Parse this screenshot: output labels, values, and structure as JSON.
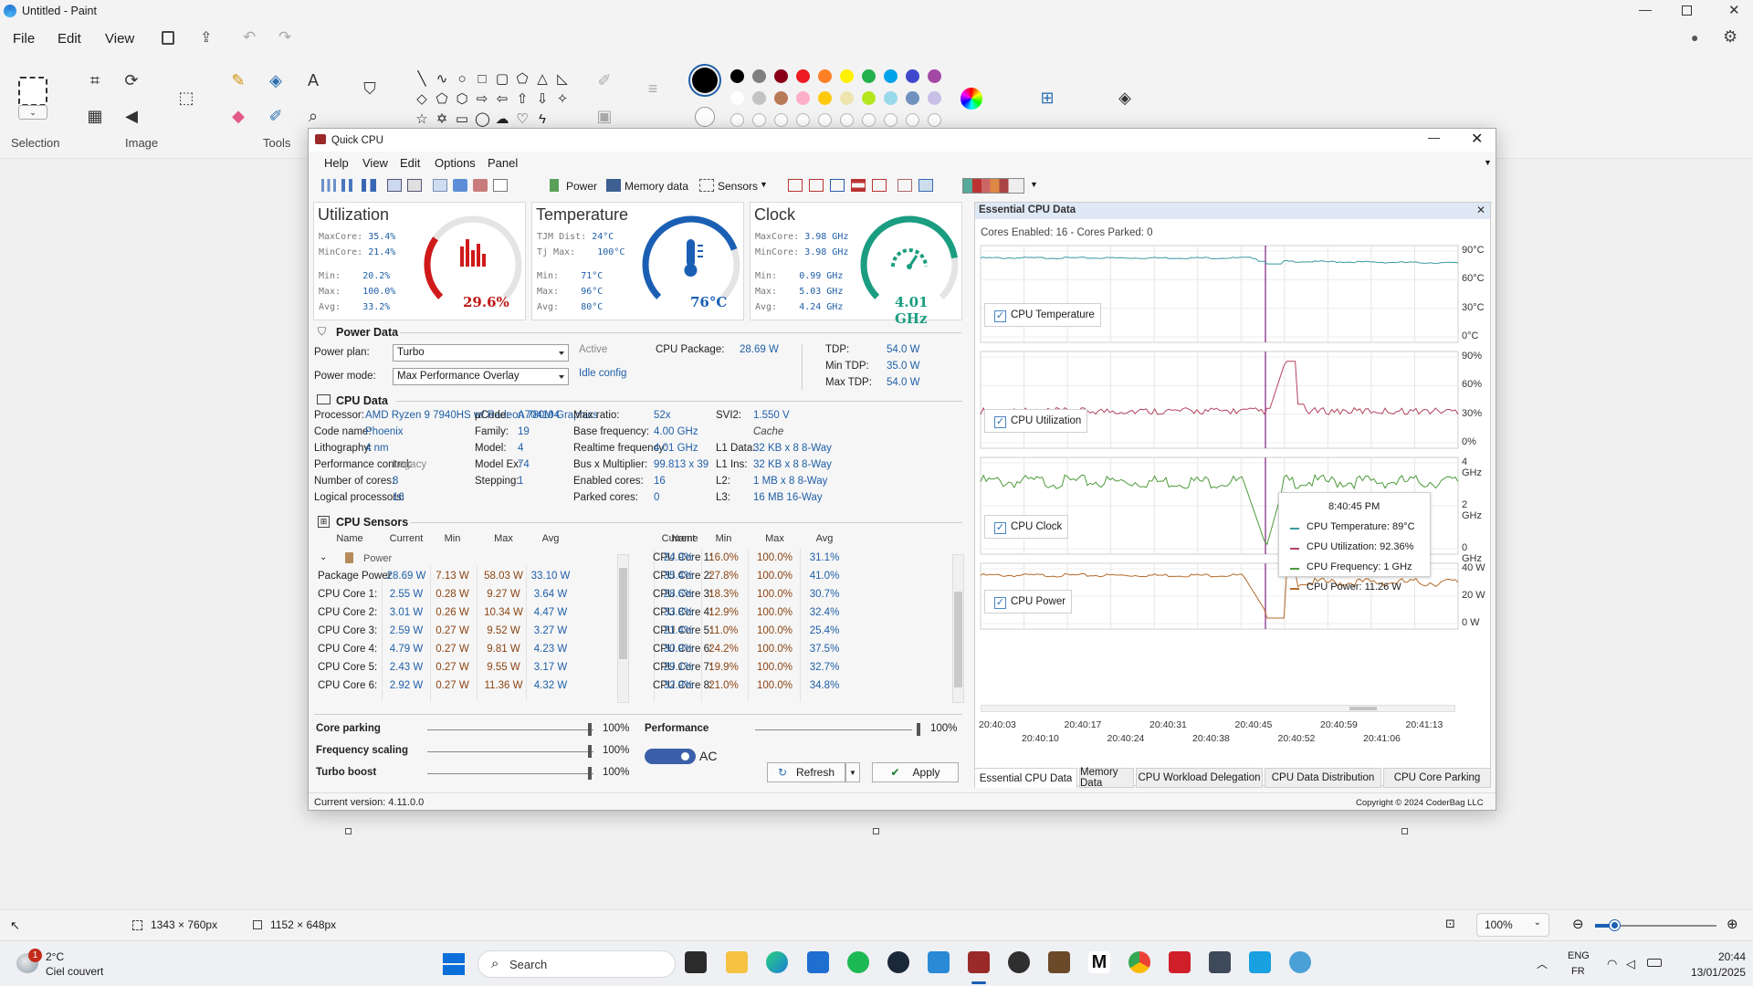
{
  "paint": {
    "title": "Untitled - Paint",
    "menu": [
      "File",
      "Edit",
      "View"
    ],
    "groups": {
      "selection": "Selection",
      "image": "Image",
      "tools": "Tools"
    },
    "status": {
      "selection_size": "1343 × 760px",
      "canvas_size": "1152 × 648px",
      "zoom": "100%"
    },
    "palette": [
      "#000000",
      "#7f7f7f",
      "#880015",
      "#ed1c24",
      "#ff7f27",
      "#fff200",
      "#22b14c",
      "#00a2e8",
      "#3f48cc",
      "#a349a4"
    ],
    "palette2": [
      "#ffffff",
      "#c3c3c3",
      "#b97a57",
      "#ffaec9",
      "#ffc90e",
      "#efe4b0",
      "#b5e61d",
      "#99d9ea",
      "#7092be",
      "#c8bfe7"
    ]
  },
  "qc": {
    "title": "Quick CPU",
    "menu": [
      "Help",
      "View",
      "Edit",
      "Options",
      "Panel"
    ],
    "toolbar": {
      "power": "Power",
      "memory": "Memory data",
      "sensors": "Sensors"
    },
    "utilization": {
      "title": "Utilization",
      "maxcore_l": "MaxCore:",
      "maxcore": "35.4%",
      "mincore_l": "MinCore:",
      "mincore": "21.4%",
      "min_l": "Min:",
      "min": "20.2%",
      "max_l": "Max:",
      "max": "100.0%",
      "avg_l": "Avg:",
      "avg": "33.2%",
      "value": "29.6%",
      "level": 0.296
    },
    "temperature": {
      "title": "Temperature",
      "tjm_l": "TJM Dist:",
      "tjm": "24°C",
      "tjmax_l": "Tj Max:",
      "tjmax": "100°C",
      "min_l": "Min:",
      "min": "71°C",
      "max_l": "Max:",
      "max": "96°C",
      "avg_l": "Avg:",
      "avg": "80°C",
      "value": "76°C",
      "level": 0.76
    },
    "clock": {
      "title": "Clock",
      "maxcore_l": "MaxCore:",
      "maxcore": "3.98 GHz",
      "mincore_l": "MinCore:",
      "mincore": "3.98 GHz",
      "min_l": "Min:",
      "min": "0.99 GHz",
      "max_l": "Max:",
      "max": "5.03 GHz",
      "avg_l": "Avg:",
      "avg": "4.24 GHz",
      "value": "4.01 GHz",
      "level": 0.8
    },
    "power_data": {
      "title": "Power Data",
      "plan_l": "Power plan:",
      "plan": "Turbo",
      "plan_state": "Active",
      "mode_l": "Power mode:",
      "mode": "Max Performance Overlay",
      "idle": "Idle config",
      "pkg_l": "CPU Package:",
      "pkg": "28.69 W",
      "tdp_l": "TDP:",
      "tdp": "54.0 W",
      "mintdp_l": "Min TDP:",
      "mintdp": "35.0 W",
      "maxtdp_l": "Max TDP:",
      "maxtdp": "54.0 W"
    },
    "cpu_data": {
      "title": "CPU Data",
      "col1": [
        [
          "Processor:",
          "AMD Ryzen 9 7940HS w/ Radeon 780M Graphics"
        ],
        [
          "Code name:",
          "Phoenix"
        ],
        [
          "Lithography:",
          "4 nm"
        ],
        [
          "Performance control:",
          "Legacy"
        ],
        [
          "Number of cores:",
          "8"
        ],
        [
          "Logical processors:",
          "16"
        ]
      ],
      "col2": [
        [
          "µCode:",
          "A704104"
        ],
        [
          "Family:",
          "19"
        ],
        [
          "Model:",
          "4"
        ],
        [
          "Model Ex:",
          "74"
        ],
        [
          "Stepping:",
          "1"
        ]
      ],
      "col3": [
        [
          "Max ratio:",
          "52x"
        ],
        [
          "Base frequency:",
          "4.00 GHz"
        ],
        [
          "Realtime frequency:",
          "4.01 GHz"
        ],
        [
          "Bus x Multiplier:",
          "99.813 x 39"
        ],
        [
          "Enabled cores:",
          "16"
        ],
        [
          "Parked cores:",
          "0"
        ]
      ],
      "col4": [
        [
          "SVI2:",
          "1.550 V"
        ],
        [
          "",
          "Cache"
        ],
        [
          "L1 Data:",
          "32 KB x 8  8-Way"
        ],
        [
          "L1 Ins:",
          "32 KB x 8  8-Way"
        ],
        [
          "L2:",
          "1 MB x 8  8-Way"
        ],
        [
          "L3:",
          "16 MB  16-Way"
        ]
      ]
    },
    "sensors": {
      "title": "CPU Sensors",
      "headers": [
        "Name",
        "Current",
        "Min",
        "Max",
        "Avg"
      ],
      "group": "Power",
      "power_rows": [
        [
          "Package Power",
          "28.69 W",
          "7.13 W",
          "58.03 W",
          "33.10 W"
        ],
        [
          "CPU Core 1:",
          "2.55 W",
          "0.28 W",
          "9.27 W",
          "3.64 W"
        ],
        [
          "CPU Core 2:",
          "3.01 W",
          "0.26 W",
          "10.34 W",
          "4.47 W"
        ],
        [
          "CPU Core 3:",
          "2.59 W",
          "0.27 W",
          "9.52 W",
          "3.27 W"
        ],
        [
          "CPU Core 4:",
          "4.79 W",
          "0.27 W",
          "9.81 W",
          "4.23 W"
        ],
        [
          "CPU Core 5:",
          "2.43 W",
          "0.27 W",
          "9.55 W",
          "3.17 W"
        ],
        [
          "CPU Core 6:",
          "2.92 W",
          "0.27 W",
          "11.36 W",
          "4.32 W"
        ]
      ],
      "util_rows": [
        [
          "CPU Core 1:",
          "24.9%",
          "16.0%",
          "100.0%",
          "31.1%"
        ],
        [
          "CPU Core 2:",
          "35.4%",
          "27.8%",
          "100.0%",
          "41.0%"
        ],
        [
          "CPU Core 3:",
          "28.6%",
          "18.3%",
          "100.0%",
          "30.7%"
        ],
        [
          "CPU Core 4:",
          "33.8%",
          "12.9%",
          "100.0%",
          "32.4%"
        ],
        [
          "CPU Core 5:",
          "21.4%",
          "11.0%",
          "100.0%",
          "25.4%"
        ],
        [
          "CPU Core 6:",
          "30.9%",
          "24.2%",
          "100.0%",
          "37.5%"
        ],
        [
          "CPU Core 7:",
          "29.1%",
          "19.9%",
          "100.0%",
          "32.7%"
        ],
        [
          "CPU Core 8:",
          "32.9%",
          "21.0%",
          "100.0%",
          "34.8%"
        ]
      ]
    },
    "controls": {
      "core_parking": "Core parking",
      "core_parking_v": "100%",
      "freq_scaling": "Frequency scaling",
      "freq_scaling_v": "100%",
      "turbo": "Turbo boost",
      "turbo_v": "100%",
      "performance": "Performance",
      "performance_v": "100%",
      "ac": "AC",
      "refresh": "Refresh",
      "apply": "Apply"
    },
    "version": "Current version:  4.11.0.0",
    "copyright": "Copyright © 2024 CoderBag LLC",
    "essential": {
      "title": "Essential CPU Data",
      "summary": "Cores Enabled: 16 - Cores Parked: 0",
      "legends": [
        "CPU Temperature",
        "CPU Utilization",
        "CPU Clock",
        "CPU Power"
      ],
      "temp_axis": [
        "90°C",
        "60°C",
        "30°C",
        "0°C"
      ],
      "util_axis": [
        "90%",
        "60%",
        "30%",
        "0%"
      ],
      "clock_axis": [
        "4 GHz",
        "2 GHz",
        "0 GHz"
      ],
      "power_axis": [
        "40 W",
        "20 W",
        "0 W"
      ],
      "time_top": [
        "20:40:03",
        "20:40:17",
        "20:40:31",
        "20:40:45",
        "20:40:59",
        "20:41:13"
      ],
      "time_bottom": [
        "20:40:10",
        "20:40:24",
        "20:40:38",
        "20:40:52",
        "20:41:06"
      ],
      "tooltip": {
        "time": "8:40:45 PM",
        "lines": [
          "CPU Temperature:  89°C",
          "CPU Utilization:  92.36%",
          "CPU Frequency:  1 GHz",
          "CPU Power:  11.26 W"
        ]
      },
      "tabs": [
        "Essential CPU Data",
        "Memory Data",
        "CPU Workload Delegation",
        "CPU Data Distribution",
        "CPU Core Parking"
      ]
    }
  },
  "taskbar": {
    "weather_temp": "2°C",
    "weather_desc": "Ciel couvert",
    "weather_badge": "1",
    "search": "Search",
    "lang1": "ENG",
    "lang2": "FR",
    "time": "20:44",
    "date": "13/01/2025"
  }
}
